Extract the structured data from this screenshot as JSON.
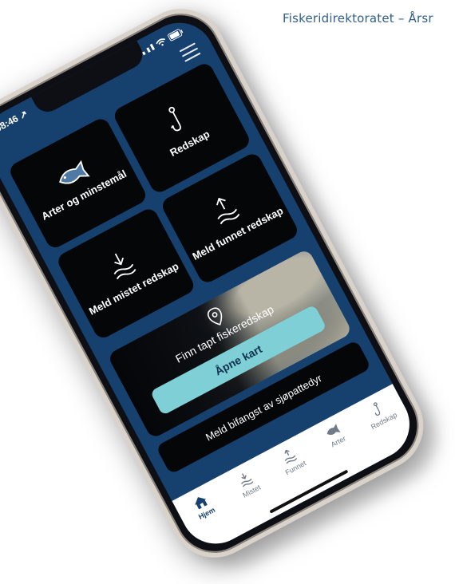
{
  "header": {
    "title": "Fiskeridirektoratet – Årsr"
  },
  "status_bar": {
    "time": "08:46 ↗"
  },
  "tiles": [
    {
      "label": "Arter og minstemål",
      "icon": "fish-icon"
    },
    {
      "label": "Redskap",
      "icon": "fishhook-icon"
    },
    {
      "label": "Meld mistet redskap",
      "icon": "arrow-down-waves-icon"
    },
    {
      "label": "Meld funnet redskap",
      "icon": "arrow-up-waves-icon"
    }
  ],
  "map_card": {
    "title": "Finn tapt fiskeredskap",
    "button_label": "Åpne kart",
    "icon": "location-pin-icon"
  },
  "bycatch_button": {
    "label": "Meld bifangst av sjøpattedyr"
  },
  "tabs": [
    {
      "label": "Hjem",
      "icon": "home-icon",
      "active": true
    },
    {
      "label": "Mistet",
      "icon": "arrow-down-waves-icon",
      "active": false
    },
    {
      "label": "Funnet",
      "icon": "arrow-up-waves-icon",
      "active": false
    },
    {
      "label": "Arter",
      "icon": "fish-icon",
      "active": false
    },
    {
      "label": "Redskap",
      "icon": "fishhook-icon",
      "active": false
    }
  ],
  "colors": {
    "screen_bg": "#16406e",
    "tile_bg": "#050608",
    "button_accent": "#7fd0d6",
    "header_text": "#2f5d8c"
  }
}
